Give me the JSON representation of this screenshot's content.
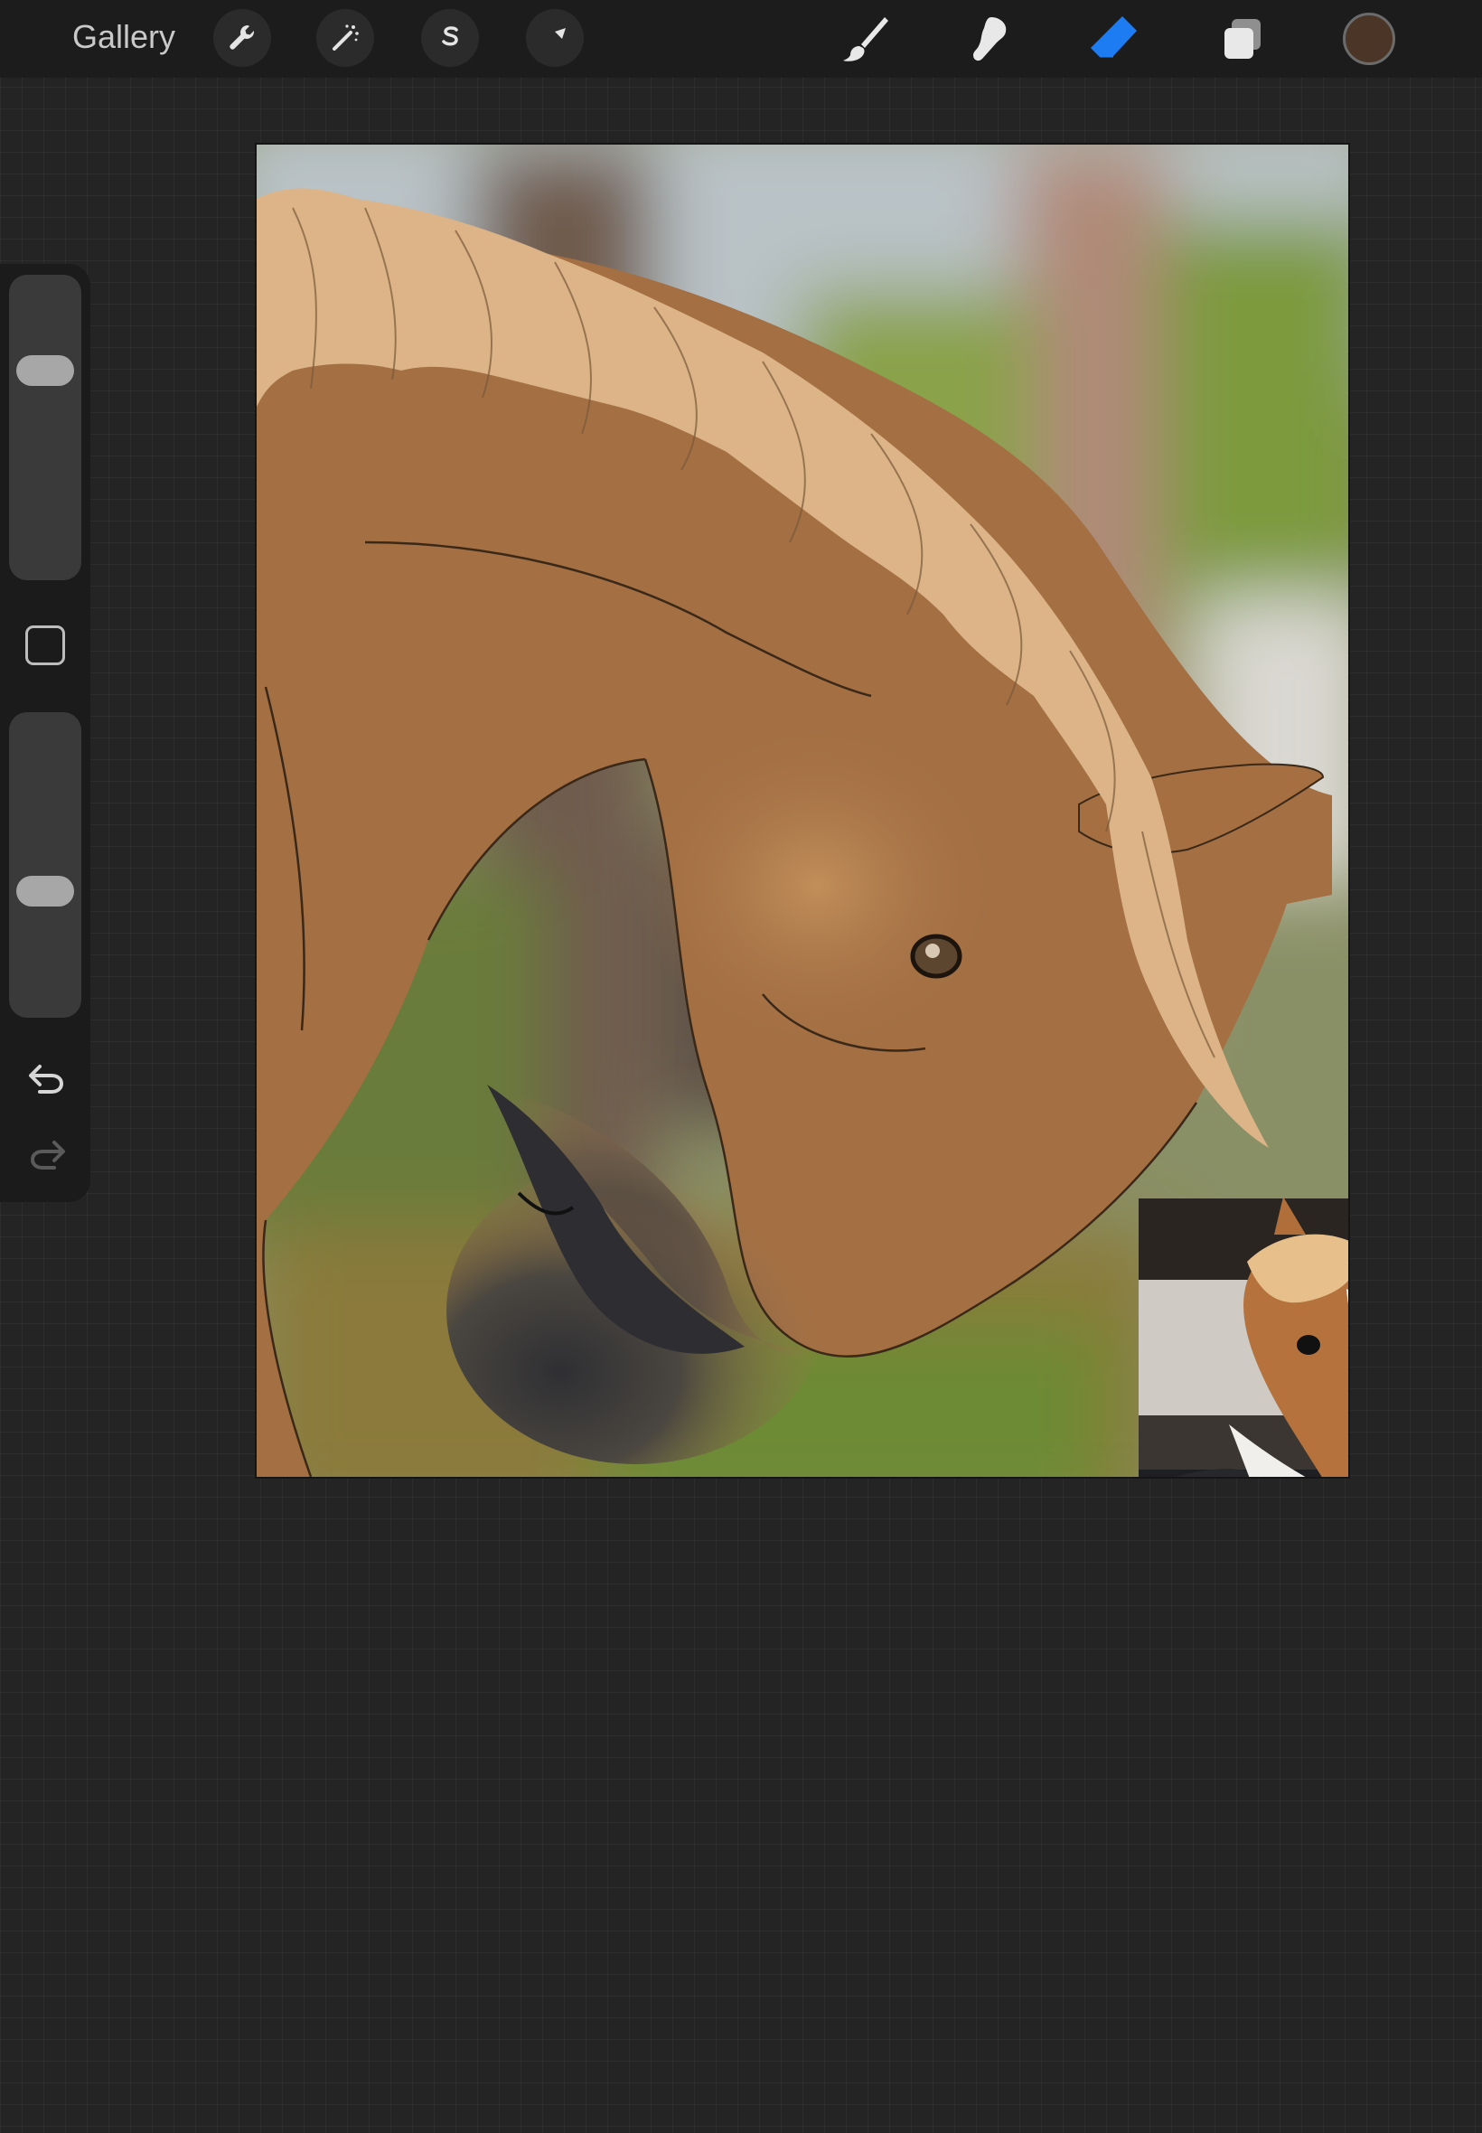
{
  "topbar": {
    "gallery_label": "Gallery",
    "left_tools": [
      "wrench-icon",
      "magic-wand-icon",
      "selection-s-icon",
      "transform-arrow-icon"
    ],
    "right_tools": [
      "brush-icon",
      "smudge-icon",
      "eraser-icon",
      "layers-icon"
    ],
    "active_tool": "eraser",
    "active_color": "#4a3527",
    "accent_color": "#1e7cf2"
  },
  "sidebar": {
    "brush_size_level": 0.72,
    "opacity_level": 0.4,
    "icons": [
      "modify-square-icon",
      "undo-icon",
      "redo-icon"
    ]
  },
  "canvas": {
    "artwork": "painting-of-chestnut-horse-head",
    "reference": "reference-photo-of-horse-with-blaze"
  }
}
